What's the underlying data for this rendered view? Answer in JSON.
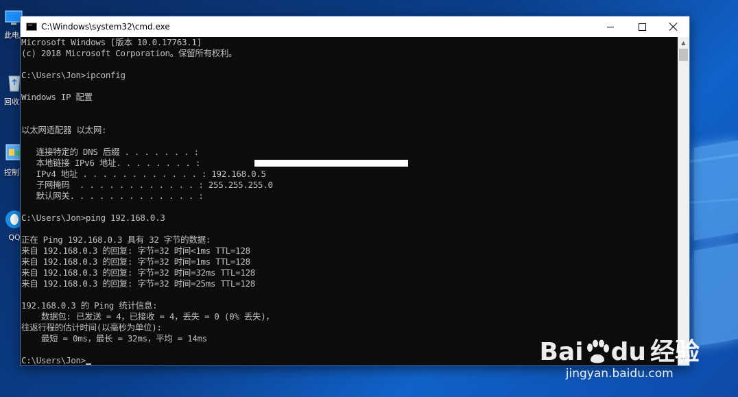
{
  "window": {
    "title": "C:\\Windows\\system32\\cmd.exe"
  },
  "desktop": {
    "icons": [
      {
        "label": "此电脑",
        "icon": "computer-icon"
      },
      {
        "label": "回收站",
        "icon": "recycle-bin-icon"
      },
      {
        "label": "控制面板",
        "icon": "control-panel-icon"
      },
      {
        "label": "QQ",
        "icon": "qq-icon"
      }
    ]
  },
  "console": {
    "lines": [
      "Microsoft Windows [版本 10.0.17763.1]",
      "(c) 2018 Microsoft Corporation。保留所有权利。",
      "",
      "C:\\Users\\Jon>ipconfig",
      "",
      "Windows IP 配置",
      "",
      "",
      "以太网适配器 以太网:",
      "",
      "   连接特定的 DNS 后缀 . . . . . . . :",
      "   本地链接 IPv6 地址. . . . . . . . :",
      "   IPv4 地址 . . . . . . . . . . . . : 192.168.0.5",
      "   子网掩码  . . . . . . . . . . . . : 255.255.255.0",
      "   默认网关. . . . . . . . . . . . . :",
      "",
      "C:\\Users\\Jon>ping 192.168.0.3",
      "",
      "正在 Ping 192.168.0.3 具有 32 字节的数据:",
      "来自 192.168.0.3 的回复: 字节=32 时间<1ms TTL=128",
      "来自 192.168.0.3 的回复: 字节=32 时间=1ms TTL=128",
      "来自 192.168.0.3 的回复: 字节=32 时间=32ms TTL=128",
      "来自 192.168.0.3 的回复: 字节=32 时间=25ms TTL=128",
      "",
      "192.168.0.3 的 Ping 统计信息:",
      "    数据包: 已发送 = 4，已接收 = 4，丢失 = 0 (0% 丢失)，",
      "往返行程的估计时间(以毫秒为单位):",
      "    最短 = 0ms，最长 = 32ms，平均 = 14ms",
      "",
      "C:\\Users\\Jon>"
    ]
  },
  "watermark": {
    "brand": "Bai",
    "brand2": "du",
    "product": "经验",
    "url": "jingyan.baidu.com"
  },
  "colors": {
    "console_bg": "#0c0c0c",
    "console_fg": "#c0c0c0",
    "titlebar_bg": "#ffffff",
    "window_border": "#3b78c9"
  }
}
